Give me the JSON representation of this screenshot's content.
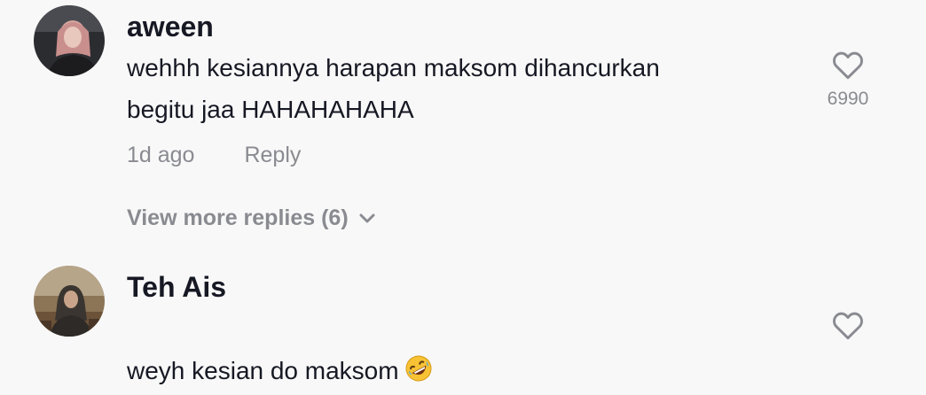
{
  "comments": [
    {
      "username": "aween",
      "text": "wehhh kesiannya harapan maksom dihancurkan\nbegitu jaa HAHAHAHAHA",
      "time": "1d ago",
      "reply_label": "Reply",
      "like_count": "6990",
      "avatar_icon": "user-avatar-photo"
    },
    {
      "username": "Teh Ais",
      "text": "weyh kesian do maksom",
      "emoji": "rolling-on-floor-laughing-emoji",
      "avatar_icon": "user-avatar-photo"
    }
  ],
  "view_more_replies": "View more replies (6)",
  "colors": {
    "background": "#f8f8f8",
    "primary_text": "#161823",
    "secondary_text": "#8a8b91"
  }
}
